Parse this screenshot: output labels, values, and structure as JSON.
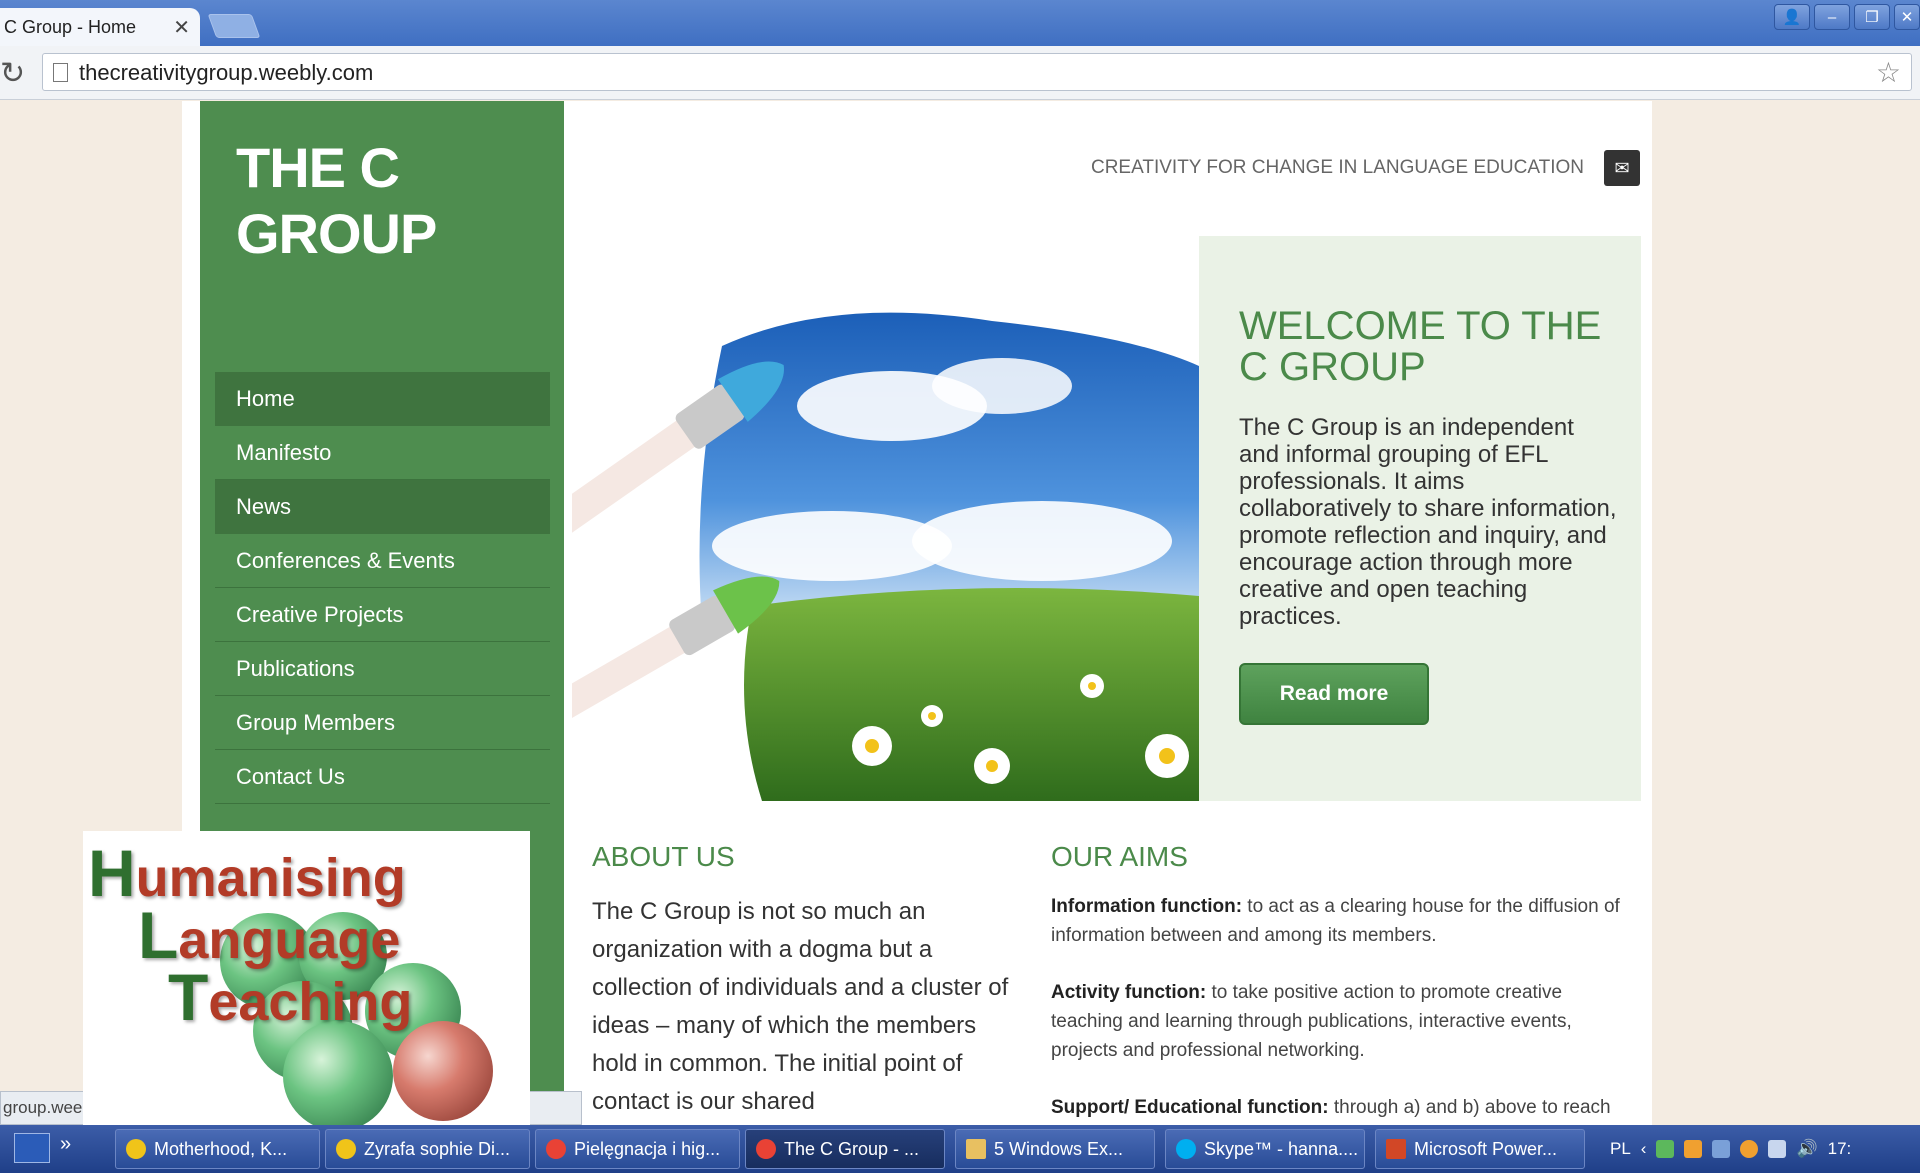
{
  "browser": {
    "tab_title": "C Group - Home",
    "url": "thecreativitygroup.weebly.com",
    "status_text": "group.wee"
  },
  "site": {
    "logo_line1": "THE C",
    "logo_line2": "GROUP",
    "tagline": "CREATIVITY FOR CHANGE IN LANGUAGE EDUCATION",
    "nav": [
      {
        "label": "Home"
      },
      {
        "label": "Manifesto"
      },
      {
        "label": "News"
      },
      {
        "label": "Conferences & Events"
      },
      {
        "label": "Creative Projects"
      },
      {
        "label": "Publications"
      },
      {
        "label": "Group Members"
      },
      {
        "label": "Contact Us"
      }
    ],
    "welcome": {
      "title": "WELCOME TO THE C GROUP",
      "text": "The C Group is an independent and informal grouping of EFL professionals. It aims collaboratively to share information, promote reflection and inquiry, and encourage action through more creative and open teaching practices.",
      "button": "Read more"
    },
    "about": {
      "title": "ABOUT US",
      "text": "The C Group is not so much an organization with a dogma but a collection of individuals and a cluster of ideas – many of which the members hold in common. The initial point of contact is our shared"
    },
    "aims": {
      "title": "OUR AIMS",
      "items": [
        {
          "label": "Information function:",
          "text": " to act as a clearing house for the diffusion of information between and among its members."
        },
        {
          "label": "Activity function:",
          "text": " to take positive action to promote creative teaching and learning through publications, interactive events, projects and professional networking."
        },
        {
          "label": "Support/ Educational function:",
          "text": " through a) and b) above to reach"
        }
      ]
    }
  },
  "overlay_logo": {
    "line1_cap": "H",
    "line1_rest": "umanising",
    "line2_cap": "L",
    "line2_rest": "anguage",
    "line3_cap": "T",
    "line3_rest": "eaching"
  },
  "taskbar": {
    "items": [
      {
        "label": "Motherhood, K..."
      },
      {
        "label": "Zyrafa sophie Di..."
      },
      {
        "label": "Pielęgnacja i hig..."
      },
      {
        "label": "The C Group - ..."
      },
      {
        "label": "5 Windows Ex..."
      },
      {
        "label": "Skype™ - hanna...."
      },
      {
        "label": "Microsoft Power..."
      }
    ],
    "lang": "PL",
    "clock": "17:"
  },
  "colors": {
    "sidebar": "#4e8d4f",
    "nav_active": "#3f743f",
    "accent_green": "#4b8a4a",
    "welcome_bg": "#eaf2e6"
  }
}
